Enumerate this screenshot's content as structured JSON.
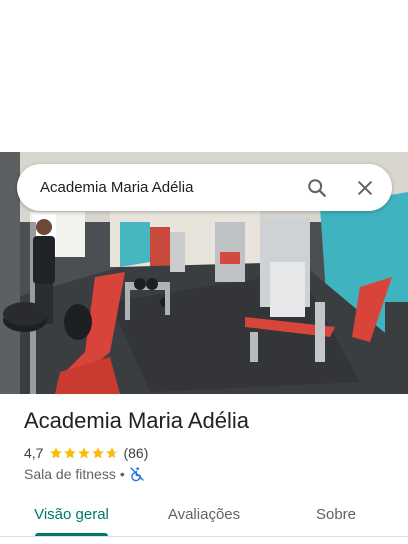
{
  "search": {
    "query": "Academia Maria Adélia"
  },
  "photo": {
    "description_icon": "gym-photo"
  },
  "place": {
    "name": "Academia Maria Adélia",
    "rating": "4,7",
    "stars_value": 4.7,
    "review_count": "(86)",
    "category": "Sala de fitness",
    "separator": "•",
    "accessibility_icon": "wheelchair-not-accessible-icon"
  },
  "tabs": [
    {
      "label": "Visão geral",
      "active": true
    },
    {
      "label": "Avaliações",
      "active": false
    },
    {
      "label": "Sobre",
      "active": false
    }
  ],
  "colors": {
    "accent": "#00796b",
    "star": "#fbbc04",
    "accessibility": "#1a73e8"
  }
}
